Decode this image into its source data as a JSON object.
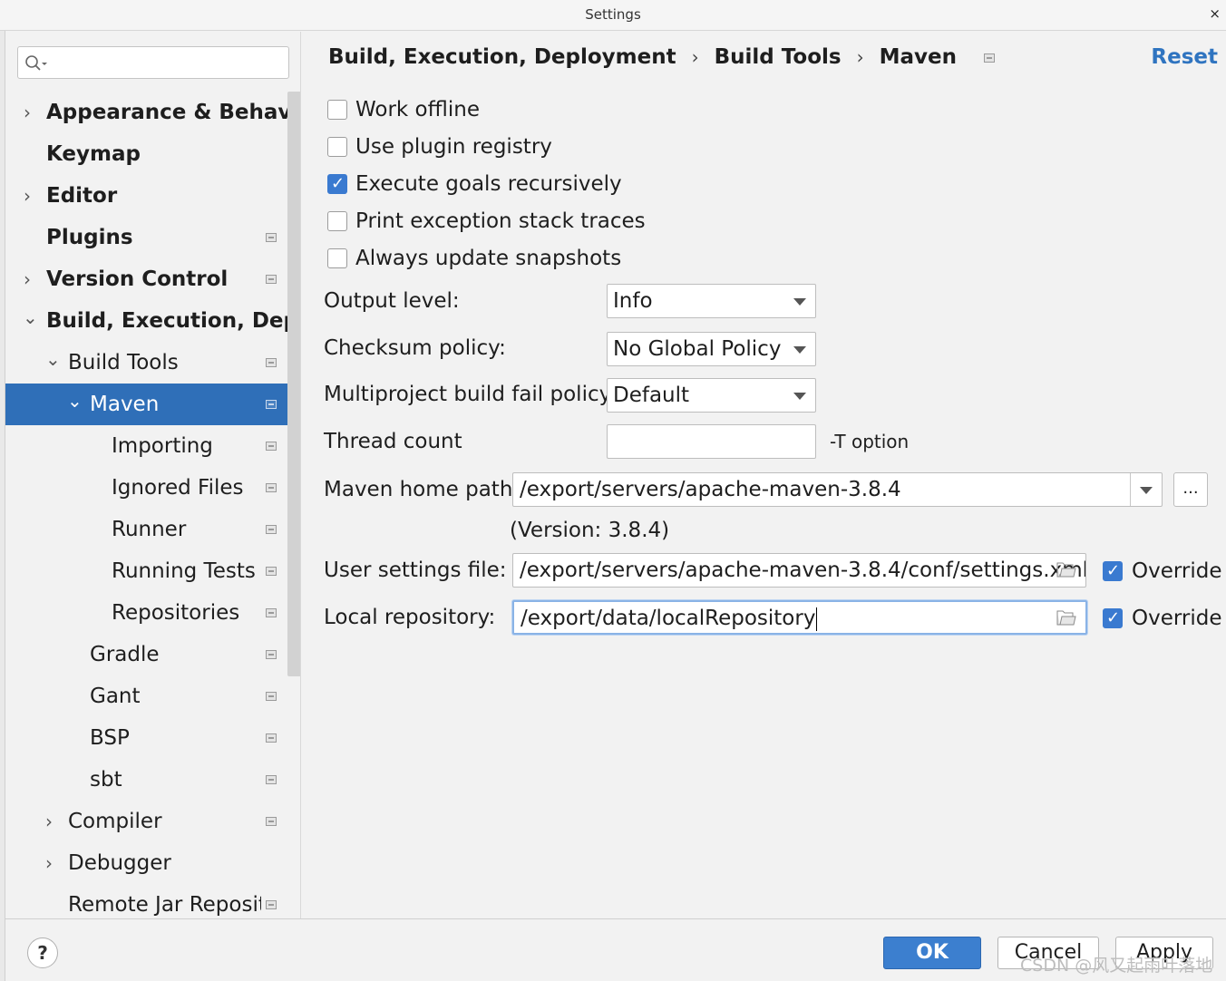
{
  "window": {
    "title": "Settings",
    "close_glyph": "×"
  },
  "sidebar": {
    "search_placeholder": "",
    "items": [
      {
        "label": "Appearance & Behavior",
        "arrow": "›"
      },
      {
        "label": "Keymap"
      },
      {
        "label": "Editor",
        "arrow": "›"
      },
      {
        "label": "Plugins"
      },
      {
        "label": "Version Control",
        "arrow": "›"
      },
      {
        "label": "Build, Execution, Deplo",
        "arrow": "⌄"
      },
      {
        "label": "Build Tools",
        "arrow": "⌄"
      },
      {
        "label": "Maven",
        "arrow": "⌄",
        "selected": true
      },
      {
        "label": "Importing"
      },
      {
        "label": "Ignored Files"
      },
      {
        "label": "Runner"
      },
      {
        "label": "Running Tests"
      },
      {
        "label": "Repositories"
      },
      {
        "label": "Gradle"
      },
      {
        "label": "Gant"
      },
      {
        "label": "BSP"
      },
      {
        "label": "sbt"
      },
      {
        "label": "Compiler",
        "arrow": "›"
      },
      {
        "label": "Debugger",
        "arrow": "›"
      },
      {
        "label": "Remote Jar Reposito"
      }
    ]
  },
  "breadcrumb": {
    "part1": "Build, Execution, Deployment",
    "part2": "Build Tools",
    "part3": "Maven",
    "separator": "›"
  },
  "reset_label": "Reset",
  "checkboxes": {
    "work_offline": {
      "label": "Work offline",
      "checked": false
    },
    "use_plugin_registry": {
      "label": "Use plugin registry",
      "checked": false
    },
    "execute_goals": {
      "label": "Execute goals recursively",
      "checked": true
    },
    "print_exception": {
      "label": "Print exception stack traces",
      "checked": false
    },
    "always_update": {
      "label": "Always update snapshots",
      "checked": false
    }
  },
  "fields": {
    "output_level": {
      "label": "Output level:",
      "value": "Info"
    },
    "checksum_policy": {
      "label": "Checksum policy:",
      "value": "No Global Policy"
    },
    "multiproject_policy": {
      "label": "Multiproject build fail policy:",
      "value": "Default"
    },
    "thread_count": {
      "label": "Thread count",
      "value": "",
      "hint": "-T option"
    },
    "maven_home": {
      "label": "Maven home path:",
      "value": "/export/servers/apache-maven-3.8.4",
      "browse": "...",
      "version": "(Version: 3.8.4)"
    },
    "user_settings": {
      "label": "User settings file:",
      "value": "/export/servers/apache-maven-3.8.4/conf/settings.xml",
      "override_label": "Override",
      "override": true
    },
    "local_repo": {
      "label": "Local repository:",
      "value": "/export/data/localRepository",
      "override_label": "Override",
      "override": true
    }
  },
  "footer": {
    "help": "?",
    "ok": "OK",
    "cancel": "Cancel",
    "apply": "Apply"
  },
  "watermark": "CSDN @风又起雨叶落地",
  "colors": {
    "accent": "#2f6fb8",
    "link": "#2f74c0",
    "checkbox_on": "#3a7ad0"
  }
}
